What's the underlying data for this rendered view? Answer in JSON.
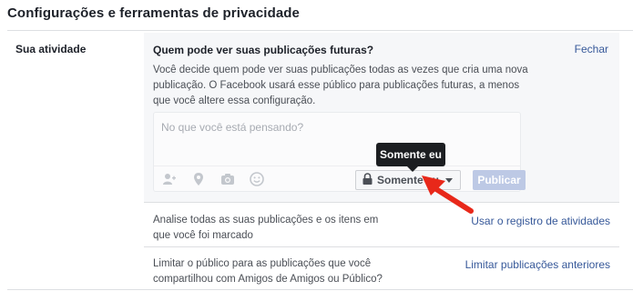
{
  "page": {
    "title": "Configurações e ferramentas de privacidade"
  },
  "section": {
    "label": "Sua atividade"
  },
  "panel": {
    "question": "Quem pode ver suas publicações futuras?",
    "close_label": "Fechar",
    "description": "Você decide quem pode ver suas publicações todas as vezes que cria uma nova publicação. O Facebook usará esse público para publicações futuras, a menos que você altere essa configuração."
  },
  "composer": {
    "placeholder": "No que você está pensando?",
    "icons": [
      "tag-person-icon",
      "location-pin-icon",
      "camera-icon",
      "emoji-icon"
    ],
    "privacy_label": "Somente eu",
    "publish_label": "Publicar"
  },
  "tooltip": {
    "text": "Somente eu"
  },
  "rows": [
    {
      "text": "Analise todas as suas publicações e os itens em que você foi marcado",
      "link": "Usar o registro de atividades"
    },
    {
      "text": "Limitar o público para as publicações que você compartilhou com Amigos de Amigos ou Público?",
      "link": "Limitar publicações anteriores"
    }
  ],
  "colors": {
    "link": "#365899",
    "panel_bg": "#f6f7f9",
    "publish_disabled": "#bdc9e5",
    "annotation_arrow": "#e8281a"
  }
}
